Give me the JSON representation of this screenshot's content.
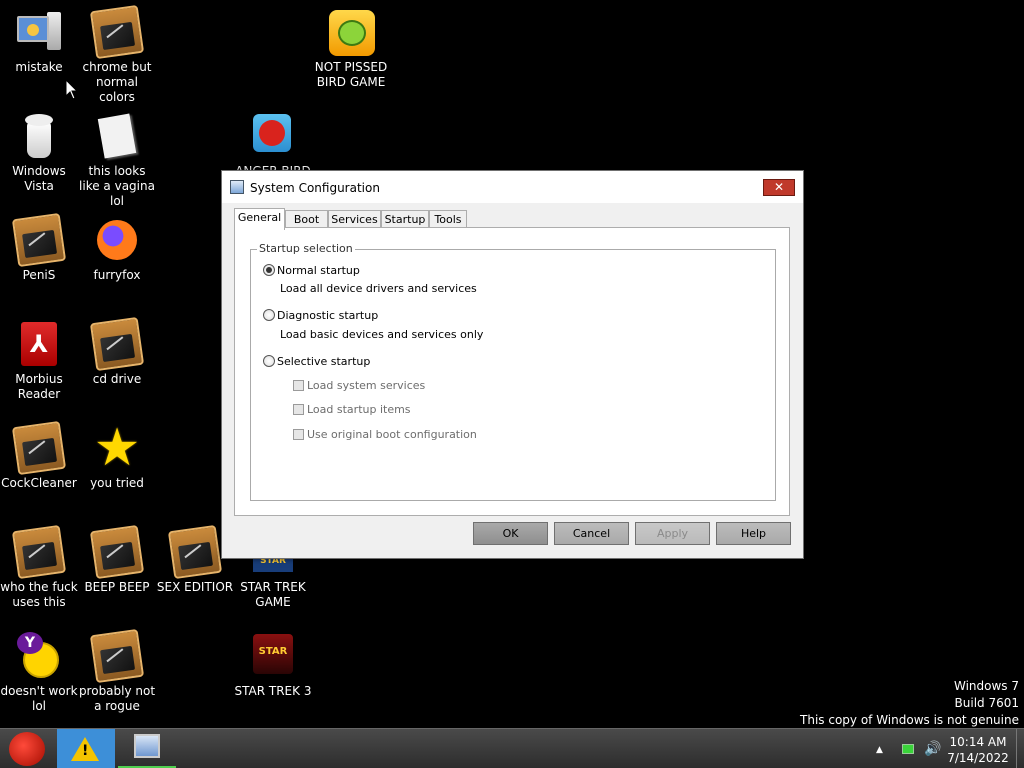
{
  "desktop": {
    "icons": [
      {
        "label": "mistake"
      },
      {
        "label": "chrome but normal colors"
      },
      {
        "label": "Windows Vista"
      },
      {
        "label": "this looks like a vagina lol"
      },
      {
        "label": "PeniS"
      },
      {
        "label": "furryfox"
      },
      {
        "label": "Morbius Reader"
      },
      {
        "label": "cd drive"
      },
      {
        "label": "CockCleaner"
      },
      {
        "label": "you tried"
      },
      {
        "label": "who the fuck uses this"
      },
      {
        "label": "BEEP BEEP"
      },
      {
        "label": "SEX EDITIOR"
      },
      {
        "label": "STAR TREK GAME"
      },
      {
        "label": "doesn't work lol"
      },
      {
        "label": "probably not a rogue"
      },
      {
        "label": "STAR TREK 3"
      },
      {
        "label": "NOT PISSED BIRD GAME"
      },
      {
        "label": "ANGER BIRD"
      }
    ]
  },
  "dialog": {
    "title": "System Configuration",
    "close_label": "✕",
    "tabs": [
      {
        "label": "General"
      },
      {
        "label": "Boot"
      },
      {
        "label": "Services"
      },
      {
        "label": "Startup"
      },
      {
        "label": "Tools"
      }
    ],
    "active_tab": "General",
    "group_title": "Startup selection",
    "options": [
      {
        "label": "Normal startup",
        "desc": "Load all device drivers and services",
        "checked": true
      },
      {
        "label": "Diagnostic startup",
        "desc": "Load basic devices and services only",
        "checked": false
      },
      {
        "label": "Selective startup",
        "desc": "",
        "checked": false
      }
    ],
    "selective_items": [
      {
        "label": "Load system services"
      },
      {
        "label": "Load startup items"
      },
      {
        "label": "Use original boot configuration"
      }
    ],
    "buttons": {
      "ok": "OK",
      "cancel": "Cancel",
      "apply": "Apply",
      "help": "Help"
    }
  },
  "watermark": {
    "line1": "Windows 7",
    "line2": "Build 7601",
    "line3": "This copy of Windows is not genuine"
  },
  "taskbar": {
    "time": "10:14 AM",
    "date": "7/14/2022"
  },
  "colors": {
    "desktop_bg": "#000000",
    "close_button": "#c0392b",
    "taskbar_active_indicator": "#4fcf4f"
  }
}
